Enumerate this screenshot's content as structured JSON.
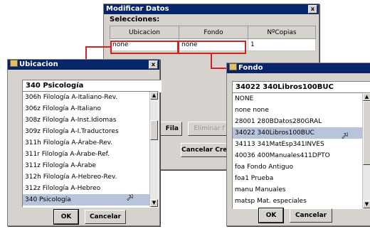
{
  "main_dialog": {
    "title": "Modificar Datos",
    "close": "x",
    "selecciones_label": "Selecciones:",
    "columns": [
      "Ubicacion",
      "Fondo",
      "NºCopias"
    ],
    "row": [
      "none",
      "none",
      "1"
    ],
    "add_row_button": "Fila",
    "delete_row_button": "Eliminar f",
    "cancel_create_button": "Cancelar Crea"
  },
  "ubicacion_dialog": {
    "title": "Ubicacion",
    "close": "x",
    "current_value": "340   Psicología",
    "items": [
      "306h  Filología A-Italiano-Rev.",
      "306z  Filología A-Italiano",
      "308z  Filología A-Inst.Idiomas",
      "309z  Filología A-I.Traductores",
      "311h  Filología A-Árabe-Rev.",
      "311r  Filología A-Árabe-Ref.",
      "311z  Filología A-Árabe",
      "312h  Filología A-Hebreo-Rev.",
      "312z  Filología A-Hebreo",
      "340   Psicología"
    ],
    "selected_index": 9,
    "ok_button": "OK",
    "cancel_button": "Cancelar"
  },
  "fondo_dialog": {
    "title": "Fondo",
    "current_value": "34022  340Libros100BUC",
    "items": [
      "NONE",
      "none  none",
      "28001  280BDatos280GRAL",
      "34022  340Libros100BUC",
      "34113  341MatEsp341INVES",
      "40036  400Manuales411DPTO",
      "foa   Fondo Antiguo",
      "foa1  Prueba",
      "manu  Manuales",
      "matsp  Mat. especiales"
    ],
    "selected_index": 3,
    "ok_button": "OK",
    "cancel_button": "Cancelar"
  },
  "colors": {
    "titlebar": "#08246b",
    "highlight": "#d82020",
    "selection": "#b8c4dc",
    "face": "#d6d3ce"
  }
}
